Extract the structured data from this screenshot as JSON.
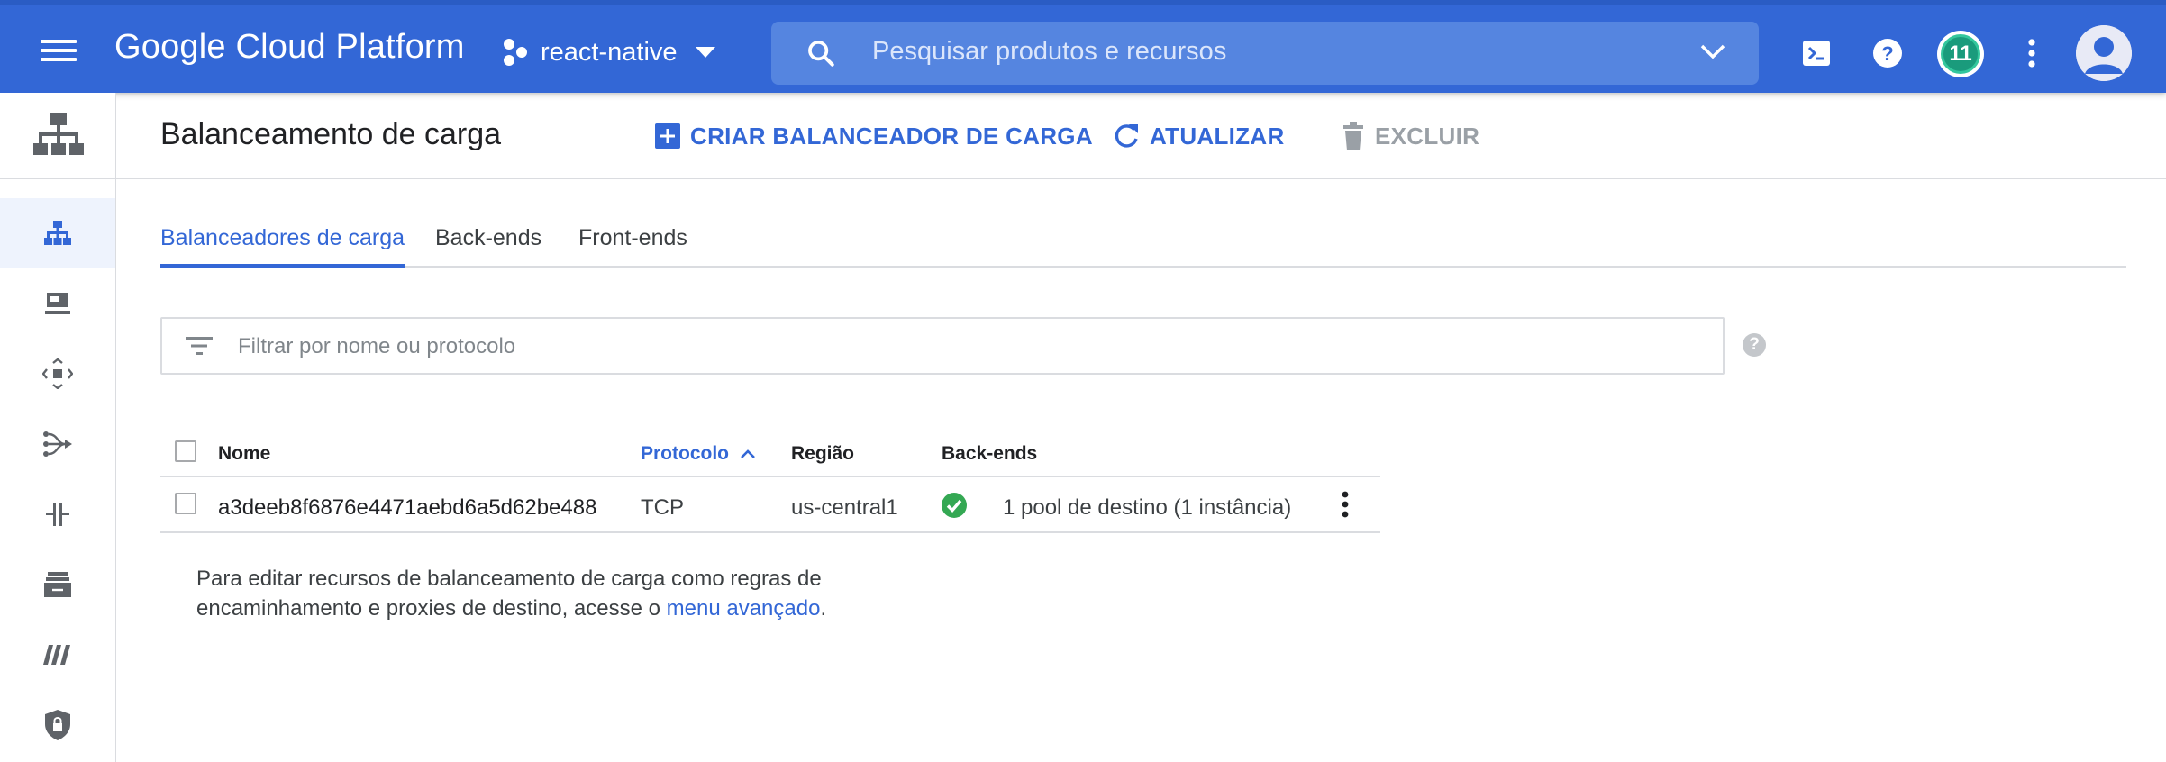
{
  "topbar": {
    "menu_icon": "hamburger-menu-icon",
    "logo": "Google Cloud Platform",
    "project_name": "react-native",
    "search_placeholder": "Pesquisar produtos e recursos",
    "notification_count": "11",
    "colors": {
      "bar": "#3367d6",
      "search": "#5585e0",
      "badge": "#1a9b7c"
    }
  },
  "leftnav": {
    "header_icon": "load-balancing-product-icon",
    "items": [
      {
        "icon": "load-balancer-icon",
        "active": true
      },
      {
        "icon": "backend-server-icon"
      },
      {
        "icon": "network-endpoint-icon"
      },
      {
        "icon": "traffic-director-icon"
      },
      {
        "icon": "interconnect-icon"
      },
      {
        "icon": "cloud-storage-icon"
      },
      {
        "icon": "network-service-icon"
      },
      {
        "icon": "cloud-armor-icon"
      }
    ]
  },
  "header": {
    "title": "Balanceamento de carga",
    "create_label": "CRIAR BALANCEADOR DE CARGA",
    "refresh_label": "ATUALIZAR",
    "delete_label": "EXCLUIR"
  },
  "tabs": [
    {
      "label": "Balanceadores de carga",
      "active": true
    },
    {
      "label": "Back-ends"
    },
    {
      "label": "Front-ends"
    }
  ],
  "filter": {
    "placeholder": "Filtrar por nome ou protocolo",
    "help": "?"
  },
  "table": {
    "columns": {
      "name": "Nome",
      "protocol": "Protocolo",
      "region": "Região",
      "backends": "Back-ends"
    },
    "sorted_column": "protocol",
    "sort_direction": "ascending",
    "rows": [
      {
        "name": "a3deeb8f6876e4471aebd6a5d62be488",
        "protocol": "TCP",
        "region": "us-central1",
        "status": "healthy",
        "backends": "1 pool de destino (1 instância)"
      }
    ]
  },
  "note": {
    "text_before": "Para editar recursos de balanceamento de carga como regras de encaminhamento e proxies de destino, acesse o ",
    "link": "menu avançado",
    "text_after": "."
  }
}
